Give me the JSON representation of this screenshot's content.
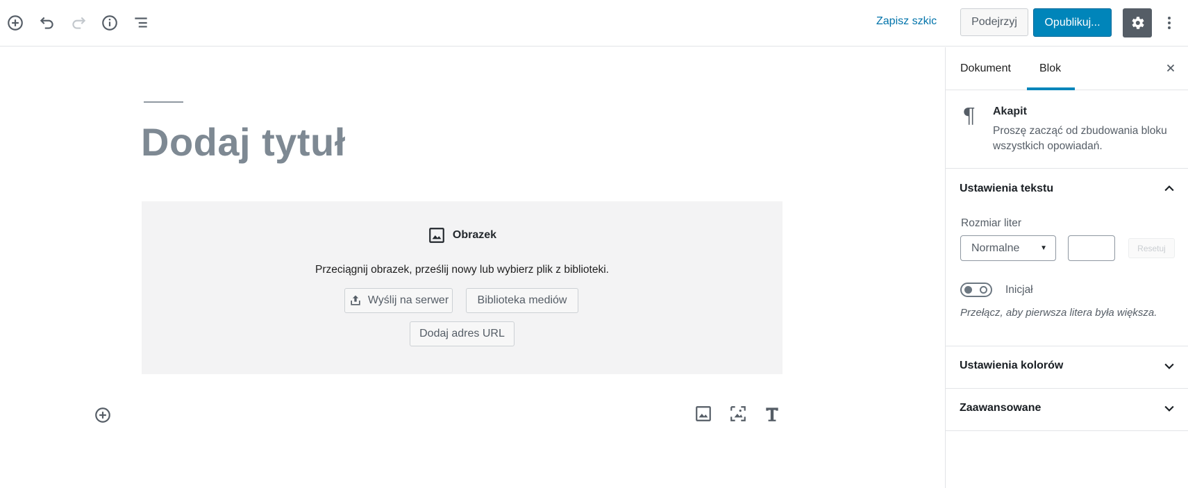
{
  "toolbar": {
    "add_block_icon": "plus-circle-icon",
    "undo_icon": "undo-icon",
    "redo_icon": "redo-icon",
    "info_icon": "info-icon",
    "outline_icon": "list-outline-icon",
    "save_draft_label": "Zapisz szkic",
    "preview_label": "Podejrzyj",
    "publish_label": "Opublikuj...",
    "settings_icon": "gear-icon",
    "more_icon": "more-vertical-icon",
    "accent_color": "#0085ba"
  },
  "editor": {
    "title_placeholder": "Dodaj tytuł",
    "image_block": {
      "label": "Obrazek",
      "instructions": "Przeciągnij obrazek, prześlij nowy lub wybierz plik z biblioteki.",
      "upload_label": "Wyślij na serwer",
      "media_library_label": "Biblioteka mediów",
      "insert_url_label": "Dodaj adres URL"
    },
    "shortcuts": [
      "image-icon",
      "gallery-icon",
      "heading-icon"
    ]
  },
  "sidebar": {
    "tabs": [
      {
        "label": "Dokument",
        "active": false
      },
      {
        "label": "Blok",
        "active": true
      }
    ],
    "block_card": {
      "icon_glyph": "¶",
      "title": "Akapit",
      "description": "Proszę zacząć od zbudowania bloku wszystkich opowiadań."
    },
    "text_settings": {
      "title": "Ustawienia tekstu",
      "font_size_label": "Rozmiar liter",
      "font_size_selected": "Normalne",
      "custom_size_value": "",
      "reset_label": "Resetuj",
      "drop_cap_label": "Inicjał",
      "drop_cap_help": "Przełącz, aby pierwsza litera była większa.",
      "drop_cap_enabled": false
    },
    "color_settings_title": "Ustawienia kolorów",
    "advanced_title": "Zaawansowane"
  }
}
